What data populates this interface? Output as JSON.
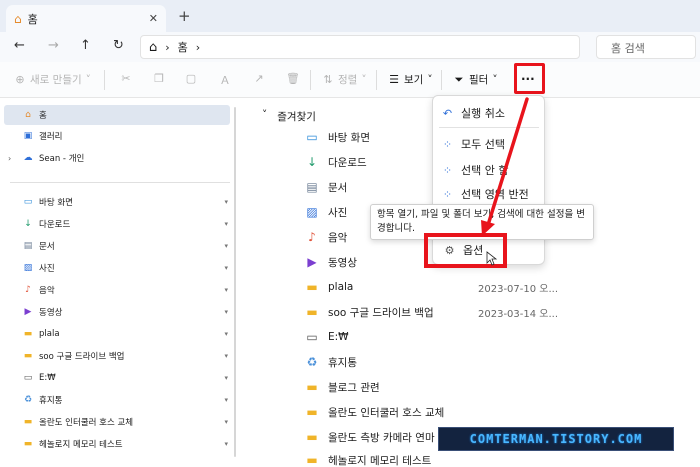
{
  "tab": {
    "title": "홈",
    "close_glyph": "✕",
    "new_glyph": "+"
  },
  "nav": {
    "back": "←",
    "forward": "→",
    "up": "↑",
    "refresh": "↻"
  },
  "address": {
    "home_glyph": "⌂",
    "crumb_sep": "›",
    "crumb": "홈",
    "trailing_sep": "›"
  },
  "search": {
    "placeholder": "홈 검색"
  },
  "commandbar": {
    "new_label": "새로 만들기",
    "sort_label": "정렬",
    "view_label": "보기",
    "filter_label": "필터",
    "more_glyph": "···",
    "chevron": "˅"
  },
  "sidebar": {
    "items": [
      {
        "icon": "home-icon",
        "glyph": "⌂",
        "label": "홈",
        "color": "#e58a2b"
      },
      {
        "icon": "gallery-icon",
        "glyph": "▣",
        "label": "갤러리",
        "color": "#2e6fd8"
      },
      {
        "icon": "cloud-icon",
        "glyph": "☁",
        "label": "Sean - 개인",
        "color": "#2e6fd8"
      }
    ],
    "pinned": [
      {
        "icon": "desktop-icon",
        "glyph": "▭",
        "label": "바탕 화면",
        "color": "#2a8ad8"
      },
      {
        "icon": "download-icon",
        "glyph": "↓",
        "label": "다운로드",
        "color": "#1f9a6b"
      },
      {
        "icon": "document-icon",
        "glyph": "▤",
        "label": "문서",
        "color": "#6b7c93"
      },
      {
        "icon": "pictures-icon",
        "glyph": "▨",
        "label": "사진",
        "color": "#2e6fd8"
      },
      {
        "icon": "music-icon",
        "glyph": "♪",
        "label": "음악",
        "color": "#e0533a"
      },
      {
        "icon": "video-icon",
        "glyph": "▶",
        "label": "동영상",
        "color": "#7b3fd0"
      },
      {
        "icon": "folder-icon",
        "glyph": "▬",
        "label": "plala",
        "color": "#f0b429"
      },
      {
        "icon": "folder-icon",
        "glyph": "▬",
        "label": "soo 구글 드라이브 백업",
        "color": "#f0b429"
      },
      {
        "icon": "drive-icon",
        "glyph": "▭",
        "label": "E:₩",
        "color": "#555555"
      },
      {
        "icon": "recycle-bin-icon",
        "glyph": "♻",
        "label": "휴지통",
        "color": "#4a90d9"
      },
      {
        "icon": "folder-icon",
        "glyph": "▬",
        "label": "올란도 인터쿨러 호스 교체",
        "color": "#f0b429"
      },
      {
        "icon": "folder-icon",
        "glyph": "▬",
        "label": "헤놀로지 메모리 테스트",
        "color": "#f0b429"
      }
    ],
    "pin_glyph": "📌"
  },
  "content": {
    "section_caret": "˅",
    "section_title": "즐겨찾기",
    "rows": [
      {
        "icon": "desktop-icon",
        "glyph": "▭",
        "color": "#2a8ad8",
        "name": "바탕 화면",
        "date": ""
      },
      {
        "icon": "download-icon",
        "glyph": "↓",
        "color": "#1f9a6b",
        "name": "다운로드",
        "date": ""
      },
      {
        "icon": "document-icon",
        "glyph": "▤",
        "color": "#6b7c93",
        "name": "문서",
        "date": ""
      },
      {
        "icon": "pictures-icon",
        "glyph": "▨",
        "color": "#2e6fd8",
        "name": "사진",
        "date": ""
      },
      {
        "icon": "music-icon",
        "glyph": "♪",
        "color": "#e0533a",
        "name": "음악",
        "date": ""
      },
      {
        "icon": "video-icon",
        "glyph": "▶",
        "color": "#7b3fd0",
        "name": "동영상",
        "date": ""
      },
      {
        "icon": "folder-icon",
        "glyph": "▬",
        "color": "#f0b429",
        "name": "plala",
        "date": "2023-07-10 오..."
      },
      {
        "icon": "folder-icon",
        "glyph": "▬",
        "color": "#f0b429",
        "name": "soo 구글 드라이브 백업",
        "date": "2023-03-14 오..."
      },
      {
        "icon": "drive-icon",
        "glyph": "▭",
        "color": "#555555",
        "name": "E:₩",
        "date": ""
      },
      {
        "icon": "recycle-bin-icon",
        "glyph": "♻",
        "color": "#4a90d9",
        "name": "휴지통",
        "date": ""
      },
      {
        "icon": "folder-icon",
        "glyph": "▬",
        "color": "#f0b429",
        "name": "블로그 관련",
        "date": ""
      },
      {
        "icon": "folder-icon",
        "glyph": "▬",
        "color": "#f0b429",
        "name": "올란도 인터쿨러 호스 교체",
        "date": ""
      },
      {
        "icon": "folder-icon",
        "glyph": "▬",
        "color": "#f0b429",
        "name": "올란도 측방 카메라 연마",
        "date": ""
      },
      {
        "icon": "folder-icon",
        "glyph": "▬",
        "color": "#f0b429",
        "name": "헤놀로지 메모리 테스트",
        "date": ""
      }
    ]
  },
  "menu": {
    "undo": "실행 취소",
    "select_all": "모두 선택",
    "select_none": "선택 안 함",
    "invert_selection": "선택 영역 반전",
    "options": "옵션"
  },
  "tooltip": {
    "text": "항목 열기, 파일 및 폴더 보기, 검색에 대한 설정을 변경합니다."
  },
  "watermark": {
    "text": "COMTERMAN.TISTORY.COM"
  },
  "colors": {
    "highlight": "#e8141c",
    "accent": "#2e6fd8",
    "watermark_bg": "#13233f",
    "watermark_text": "#49b7ff"
  }
}
